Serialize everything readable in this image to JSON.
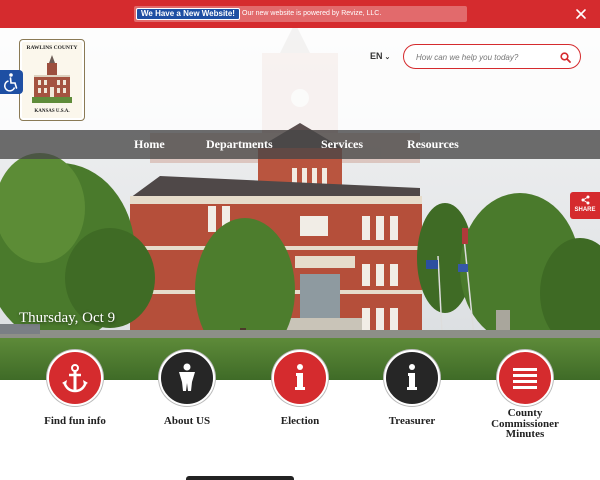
{
  "banner": {
    "badge": "We Have a New Website!",
    "message": "Our new website is powered by Revize, LLC.",
    "close_icon": "close-icon",
    "color": "#d52b2e"
  },
  "logo": {
    "top_text": "RAWLINS COUNTY",
    "bottom_text": "KANSAS   U.S.A."
  },
  "header": {
    "language": "EN",
    "search_placeholder": "How can we help you today?",
    "search_icon": "search-icon"
  },
  "nav": {
    "items": [
      {
        "label": "Home"
      },
      {
        "label": "Departments"
      },
      {
        "label": "Services"
      },
      {
        "label": "Resources"
      }
    ]
  },
  "share": {
    "label": "SHARE",
    "icon": "share-icon"
  },
  "hero": {
    "date": "Thursday, Oct 9"
  },
  "quick_links": [
    {
      "label": "Find fun info",
      "icon": "anchor-icon",
      "color": "#d52b2e"
    },
    {
      "label": "About US",
      "icon": "person-icon",
      "color": "#262626"
    },
    {
      "label": "Election",
      "icon": "info-icon",
      "color": "#d52b2e"
    },
    {
      "label": "Treasurer",
      "icon": "info-icon",
      "color": "#262626"
    },
    {
      "label": "County Commissioner Minutes",
      "icon": "menu-list-icon",
      "color": "#d52b2e"
    }
  ],
  "colors": {
    "accent": "#d52b2e",
    "dark": "#262626",
    "a11y_blue": "#1e4fa3"
  }
}
